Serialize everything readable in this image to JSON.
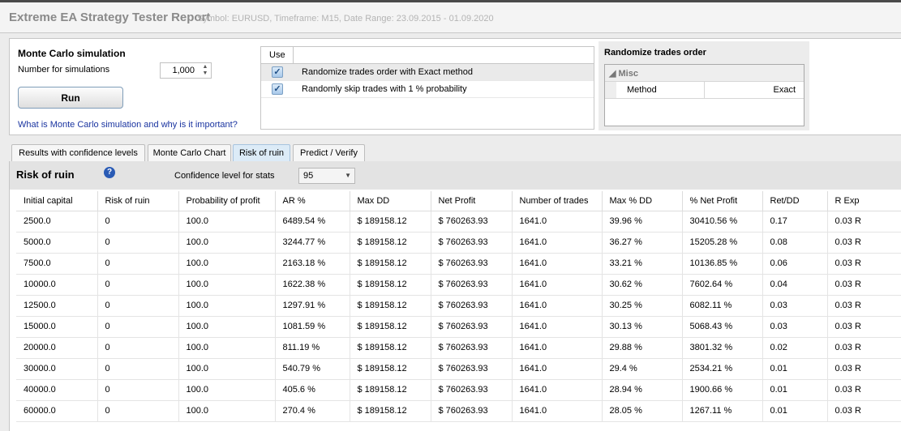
{
  "header": {
    "title": "Extreme EA Strategy Tester Report",
    "subtitle": "Symbol: EURUSD, Timeframe: M15, Date Range: 23.09.2015 - 01.09.2020"
  },
  "monte_carlo": {
    "title": "Monte Carlo simulation",
    "num_label": "Number for simulations",
    "num_value": "1,000",
    "run_label": "Run",
    "help_link": "What is Monte Carlo simulation and why is it important?"
  },
  "use_table": {
    "header": "Use",
    "rows": [
      {
        "text": "Randomize trades order with Exact method",
        "checked": true
      },
      {
        "text": "Randomly skip trades with 1 % probability",
        "checked": true
      }
    ]
  },
  "randomize": {
    "title": "Randomize trades order",
    "group": "Misc",
    "prop_key": "Method",
    "prop_value": "Exact"
  },
  "tabs": [
    "Results with confidence levels",
    "Monte Carlo Chart",
    "Risk of ruin",
    "Predict / Verify"
  ],
  "active_tab": "Risk of ruin",
  "risk_of_ruin": {
    "title": "Risk of ruin",
    "help_icon": "?",
    "confidence_label": "Confidence level for stats",
    "confidence_value": "95",
    "columns": [
      "Initial capital",
      "Risk of ruin",
      "Probability of profit",
      "AR %",
      "Max DD",
      "Net Profit",
      "Number of trades",
      "Max % DD",
      "% Net Profit",
      "Ret/DD",
      "R Exp"
    ],
    "rows": [
      [
        "2500.0",
        "0",
        "100.0",
        "6489.54 %",
        "$ 189158.12",
        "$ 760263.93",
        "1641.0",
        "39.96 %",
        "30410.56 %",
        "0.17",
        "0.03 R"
      ],
      [
        "5000.0",
        "0",
        "100.0",
        "3244.77 %",
        "$ 189158.12",
        "$ 760263.93",
        "1641.0",
        "36.27 %",
        "15205.28 %",
        "0.08",
        "0.03 R"
      ],
      [
        "7500.0",
        "0",
        "100.0",
        "2163.18 %",
        "$ 189158.12",
        "$ 760263.93",
        "1641.0",
        "33.21 %",
        "10136.85 %",
        "0.06",
        "0.03 R"
      ],
      [
        "10000.0",
        "0",
        "100.0",
        "1622.38 %",
        "$ 189158.12",
        "$ 760263.93",
        "1641.0",
        "30.62 %",
        "7602.64 %",
        "0.04",
        "0.03 R"
      ],
      [
        "12500.0",
        "0",
        "100.0",
        "1297.91 %",
        "$ 189158.12",
        "$ 760263.93",
        "1641.0",
        "30.25 %",
        "6082.11 %",
        "0.03",
        "0.03 R"
      ],
      [
        "15000.0",
        "0",
        "100.0",
        "1081.59 %",
        "$ 189158.12",
        "$ 760263.93",
        "1641.0",
        "30.13 %",
        "5068.43 %",
        "0.03",
        "0.03 R"
      ],
      [
        "20000.0",
        "0",
        "100.0",
        "811.19 %",
        "$ 189158.12",
        "$ 760263.93",
        "1641.0",
        "29.88 %",
        "3801.32 %",
        "0.02",
        "0.03 R"
      ],
      [
        "30000.0",
        "0",
        "100.0",
        "540.79 %",
        "$ 189158.12",
        "$ 760263.93",
        "1641.0",
        "29.4 %",
        "2534.21 %",
        "0.01",
        "0.03 R"
      ],
      [
        "40000.0",
        "0",
        "100.0",
        "405.6 %",
        "$ 189158.12",
        "$ 760263.93",
        "1641.0",
        "28.94 %",
        "1900.66 %",
        "0.01",
        "0.03 R"
      ],
      [
        "60000.0",
        "0",
        "100.0",
        "270.4 %",
        "$ 189158.12",
        "$ 760263.93",
        "1641.0",
        "28.05 %",
        "1267.11 %",
        "0.01",
        "0.03 R"
      ]
    ]
  },
  "colors": {
    "link": "#1a34a0",
    "active_tab": "#dcebf7",
    "header_band": "#e3e3e3"
  }
}
